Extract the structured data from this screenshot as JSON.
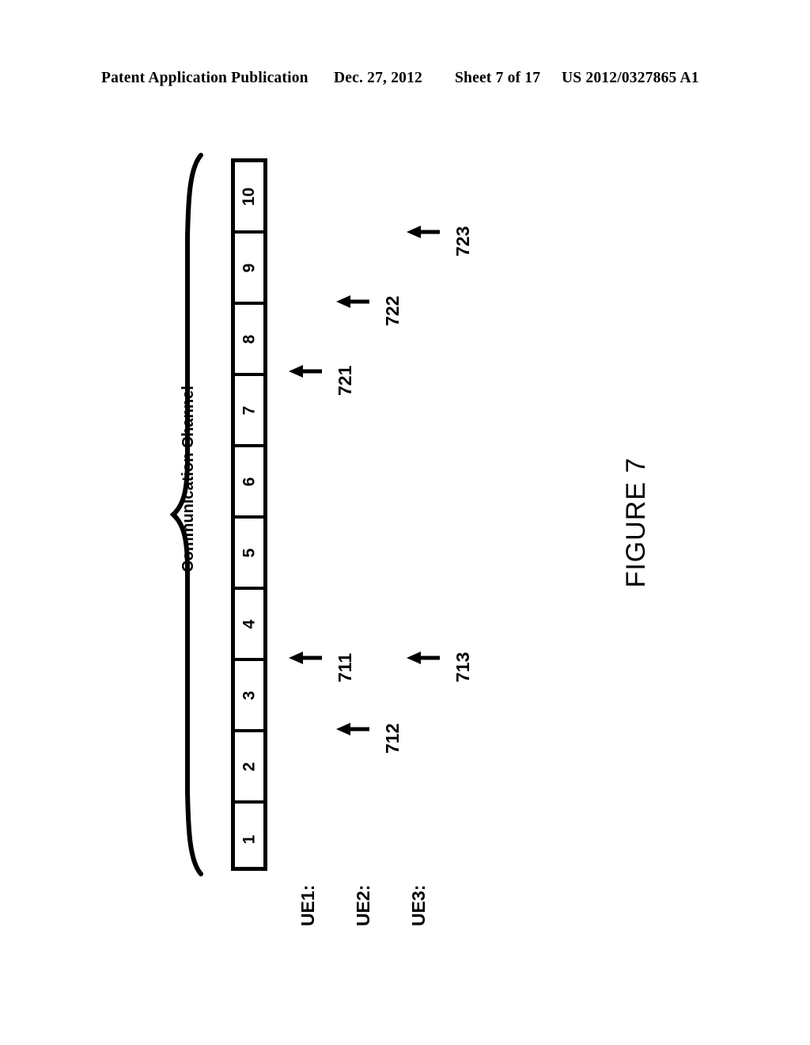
{
  "header": {
    "publication": "Patent Application Publication",
    "date": "Dec. 27, 2012",
    "sheet": "Sheet 7 of 17",
    "patent_number": "US 2012/0327865 A1"
  },
  "figure": {
    "caption": "FIGURE 7",
    "channel_caption": "Communication Channel"
  },
  "channel": {
    "slots": [
      {
        "label": "10"
      },
      {
        "label": "9"
      },
      {
        "label": "8"
      },
      {
        "label": "7"
      },
      {
        "label": "6"
      },
      {
        "label": "5"
      },
      {
        "label": "4"
      },
      {
        "label": "3"
      },
      {
        "label": "2"
      },
      {
        "label": "1"
      }
    ]
  },
  "ue_rows": [
    {
      "label": "UE1:"
    },
    {
      "label": "UE2:"
    },
    {
      "label": "UE3:"
    }
  ],
  "annotations": [
    {
      "ref": "711"
    },
    {
      "ref": "712"
    },
    {
      "ref": "713"
    },
    {
      "ref": "721"
    },
    {
      "ref": "722"
    },
    {
      "ref": "723"
    }
  ],
  "colors": {
    "ink": "#000000",
    "page": "#ffffff"
  }
}
